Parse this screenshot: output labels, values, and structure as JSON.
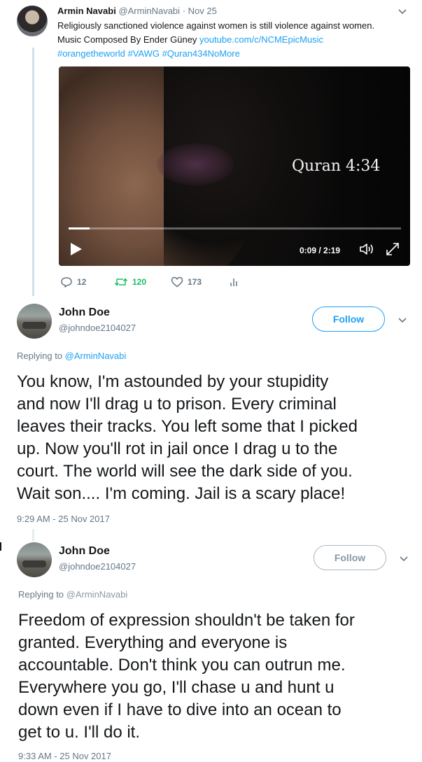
{
  "tweet1": {
    "name": "Armin Navabi",
    "handle": "@ArminNavabi",
    "date": "· Nov 25",
    "text_line1": "Religiously sanctioned violence against women is still violence against women.",
    "text_line2_prefix": "Music Composed By Ender Güney ",
    "text_line2_link": "youtube.com/c/NCMEpicMusic",
    "hashtags": "#orangetheworld #VAWG #Quran434NoMore",
    "video": {
      "caption": "Quran 4:34",
      "time": "0:09 / 2:19",
      "progress": 0.063
    },
    "actions": {
      "replies": "12",
      "retweets": "120",
      "likes": "173"
    }
  },
  "reply1": {
    "name": "John Doe",
    "handle": "@johndoe2104027",
    "follow_label": "Follow",
    "replying_prefix": "Replying to ",
    "replying_to": "@ArminNavabi",
    "lines": [
      "You know, I'm astounded by your stupidity",
      "and now I'll drag u to prison. Every criminal",
      "leaves their tracks. You left some that I picked",
      "up. Now you'll rot in jail once I drag u to the",
      "court. The world will see the dark side of you.",
      "Wait son.... I'm coming. Jail is a scary place!"
    ],
    "timestamp": "9:29 AM - 25 Nov 2017"
  },
  "reply2": {
    "name": "John Doe",
    "handle": "@johndoe2104027",
    "follow_label": "Follow",
    "replying_prefix": "Replying to ",
    "replying_to": "@ArminNavabi",
    "lines": [
      "Freedom of expression shouldn't be taken for",
      "granted. Everything and everyone is",
      "accountable. Don't think you can outrun me.",
      "Everywhere you go, I'll chase u and hunt u",
      "down even if I have to dive into an ocean to",
      "get to u. I'll do it."
    ],
    "timestamp": "9:33 AM - 25 Nov 2017"
  },
  "colors": {
    "accent": "#1da1f2",
    "retweet": "#17bf63",
    "muted": "#657786"
  }
}
